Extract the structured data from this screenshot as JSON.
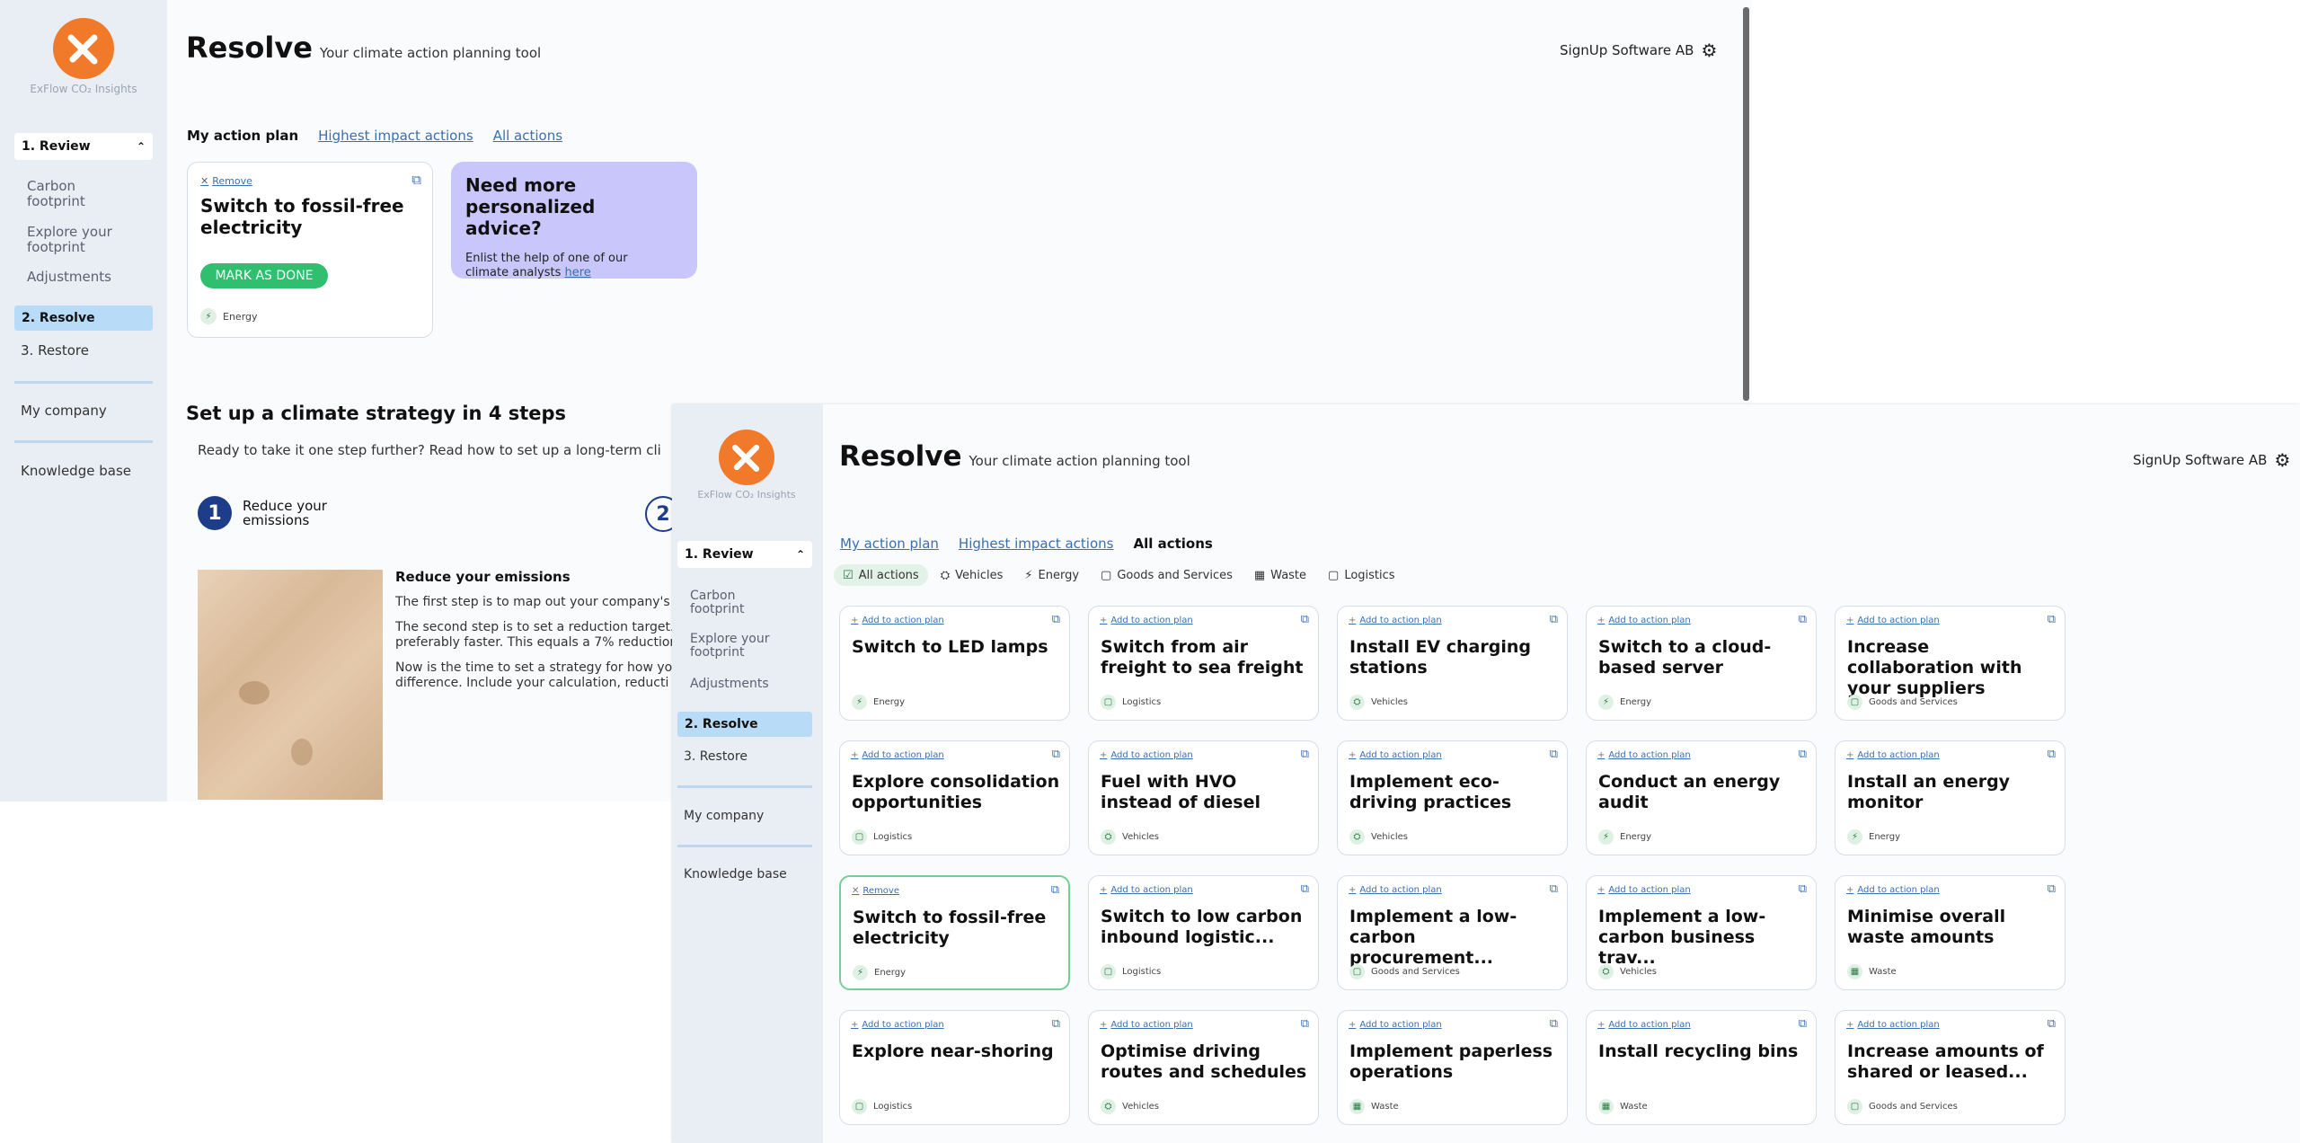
{
  "app": {
    "logo_text": "ExFlow CO₂ Insights",
    "company": "SignUp Software AB",
    "title": "Resolve",
    "subtitle": "Your climate action planning tool"
  },
  "sidebar": {
    "review": "1. Review",
    "review_items": [
      "Carbon footprint",
      "Explore your footprint",
      "Adjustments"
    ],
    "resolve": "2. Resolve",
    "restore": "3. Restore",
    "my_company": "My company",
    "knowledge_base": "Knowledge base"
  },
  "tabs": {
    "my_action_plan": "My action plan",
    "highest_impact": "Highest impact actions",
    "all_actions": "All actions"
  },
  "back_window": {
    "plan_card": {
      "remove": "Remove",
      "title": "Switch to fossil-free electricity",
      "button": "MARK AS DONE",
      "category": "Energy"
    },
    "advice": {
      "title": "Need more personalized advice?",
      "text": "Enlist the help of one of our climate analysts",
      "link": "here"
    },
    "strategy": {
      "heading": "Set up a climate strategy in 4 steps",
      "intro": "Ready to take it one step further? Read how to set up a long-term cli",
      "step1_num": "1",
      "step1_label": "Reduce your emissions",
      "step2_num": "2",
      "section_title": "Reduce your emissions",
      "para1": "The first step is to map out your company's c",
      "para2a": "The second step is to set a reduction target.",
      "para2b": "preferably faster. This equals a 7% reduction",
      "para3a": "Now is the time to set a strategy for how yo",
      "para3b": "difference. Include your calculation, reducti"
    }
  },
  "front_window": {
    "filters": [
      "All actions",
      "Vehicles",
      "Energy",
      "Goods and Services",
      "Waste",
      "Logistics"
    ],
    "add_label": "Add to action plan",
    "remove_label": "Remove",
    "cards": [
      {
        "title": "Switch to LED lamps",
        "category": "Energy",
        "selected": false
      },
      {
        "title": "Switch from air freight to sea freight",
        "category": "Logistics",
        "selected": false
      },
      {
        "title": "Install EV charging stations",
        "category": "Vehicles",
        "selected": false
      },
      {
        "title": "Switch to a cloud-based server",
        "category": "Energy",
        "selected": false
      },
      {
        "title": "Increase collaboration with your suppliers",
        "category": "Goods and Services",
        "selected": false
      },
      {
        "title": "Explore consolidation opportunities",
        "category": "Logistics",
        "selected": false
      },
      {
        "title": "Fuel with HVO instead of diesel",
        "category": "Vehicles",
        "selected": false
      },
      {
        "title": "Implement eco-driving practices",
        "category": "Vehicles",
        "selected": false
      },
      {
        "title": "Conduct an energy audit",
        "category": "Energy",
        "selected": false
      },
      {
        "title": "Install an energy monitor",
        "category": "Energy",
        "selected": false
      },
      {
        "title": "Switch to fossil-free electricity",
        "category": "Energy",
        "selected": true
      },
      {
        "title": "Switch to low carbon inbound logistic...",
        "category": "Logistics",
        "selected": false
      },
      {
        "title": "Implement a low-carbon procurement...",
        "category": "Goods and Services",
        "selected": false
      },
      {
        "title": "Implement a low-carbon business trav...",
        "category": "Vehicles",
        "selected": false
      },
      {
        "title": "Minimise overall waste amounts",
        "category": "Waste",
        "selected": false
      },
      {
        "title": "Explore near-shoring",
        "category": "Logistics",
        "selected": false
      },
      {
        "title": "Optimise driving routes and schedules",
        "category": "Vehicles",
        "selected": false
      },
      {
        "title": "Implement paperless operations",
        "category": "Waste",
        "selected": false
      },
      {
        "title": "Install recycling bins",
        "category": "Waste",
        "selected": false
      },
      {
        "title": "Increase amounts of shared or leased...",
        "category": "Goods and Services",
        "selected": false
      }
    ]
  },
  "colors": {
    "accent": "#f07a2a",
    "green": "#2fbf6f",
    "link": "#3a6fb0",
    "active_nav": "#b8dcf7",
    "advice": "#c8c6fa"
  }
}
